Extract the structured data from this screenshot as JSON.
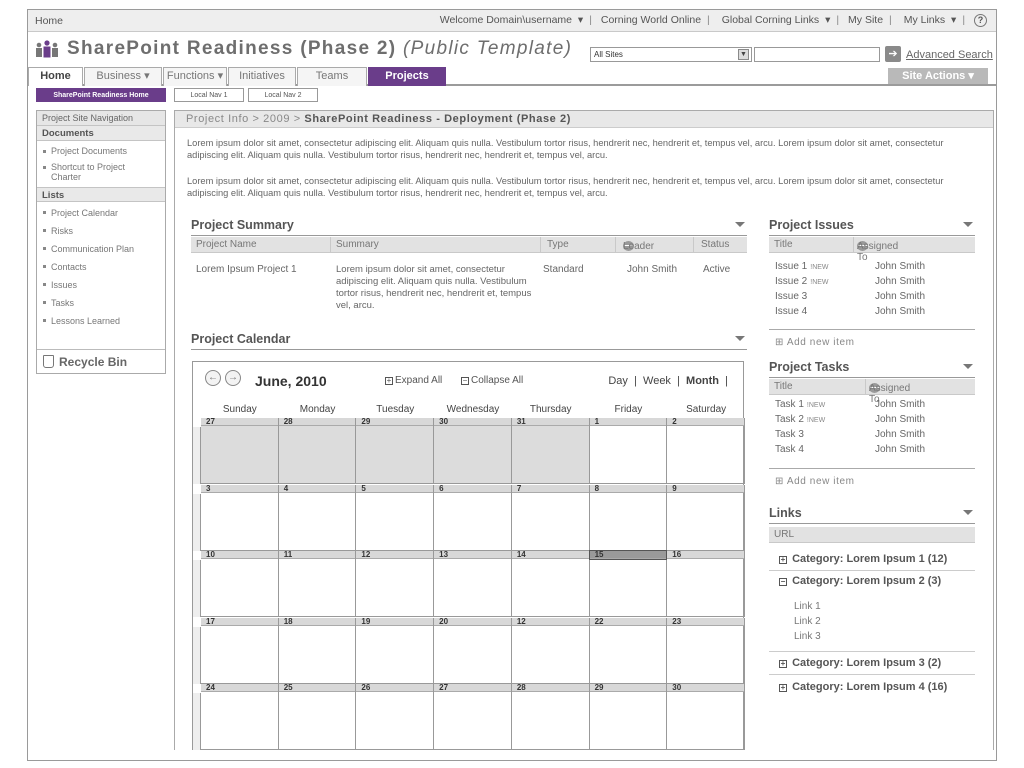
{
  "topbar": {
    "home": "Home",
    "welcome": "Welcome Domain\\username",
    "links": [
      "Corning World Online",
      "Global Corning Links",
      "My Site",
      "My Links"
    ],
    "help": "?"
  },
  "header": {
    "title": "SharePoint Readiness (Phase 2)",
    "subtitle": "(Public Template)",
    "scope_value": "All Sites",
    "advanced_search": "Advanced Search"
  },
  "tabs": [
    {
      "label": "Home"
    },
    {
      "label": "Business ▾"
    },
    {
      "label": "Functions ▾"
    },
    {
      "label": "Initiatives"
    },
    {
      "label": "Teams"
    },
    {
      "label": "Projects"
    }
  ],
  "site_actions": "Site Actions ▾",
  "local_nav": [
    "SharePoint Readiness Home",
    "Local Nav 1",
    "Local Nav 2"
  ],
  "leftnav": {
    "heading": "Project Site Navigation",
    "documents_label": "Documents",
    "documents": [
      "Project Documents",
      "Shortcut to Project Charter"
    ],
    "lists_label": "Lists",
    "lists": [
      "Project Calendar",
      "Risks",
      "Communication Plan",
      "Contacts",
      "Issues",
      "Tasks",
      "Lessons Learned"
    ],
    "recycle": "Recycle Bin"
  },
  "breadcrumb": {
    "path": "Project Info > 2009 > ",
    "current": "SharePoint Readiness - Deployment (Phase 2)"
  },
  "intro": [
    "Lorem ipsum dolor sit amet, consectetur adipiscing elit. Aliquam quis nulla. Vestibulum tortor risus, hendrerit nec, hendrerit et, tempus vel, arcu. Lorem ipsum dolor sit amet, consectetur adipiscing elit. Aliquam quis nulla. Vestibulum tortor risus, hendrerit nec, hendrerit et, tempus vel, arcu.",
    "Lorem ipsum dolor sit amet, consectetur adipiscing elit. Aliquam quis nulla. Vestibulum tortor risus, hendrerit nec, hendrerit et, tempus vel, arcu. Lorem ipsum dolor sit amet, consectetur adipiscing elit. Aliquam quis nulla. Vestibulum tortor risus, hendrerit nec, hendrerit et, tempus vel, arcu."
  ],
  "summary": {
    "title": "Project Summary",
    "columns": [
      "Project Name",
      "Summary",
      "Type",
      "Leader",
      "Status"
    ],
    "row": {
      "name": "Lorem Ipsum Project 1",
      "summary": "Lorem ipsum dolor sit amet, consectetur adipiscing elit. Aliquam quis nulla. Vestibulum tortor risus, hendrerit nec, hendrerit et, tempus vel, arcu.",
      "type": "Standard",
      "leader": "John Smith",
      "status": "Active"
    }
  },
  "calendar": {
    "title": "Project Calendar",
    "month": "June, 2010",
    "expand": "Expand All",
    "collapse": "Collapse All",
    "views": [
      "Day",
      "Week",
      "Month"
    ],
    "days": [
      "Sunday",
      "Monday",
      "Tuesday",
      "Wednesday",
      "Thursday",
      "Friday",
      "Saturday"
    ],
    "weeks": [
      [
        "27",
        "28",
        "29",
        "30",
        "31",
        "1",
        "2"
      ],
      [
        "3",
        "4",
        "5",
        "6",
        "7",
        "8",
        "9"
      ],
      [
        "10",
        "11",
        "12",
        "13",
        "14",
        "15",
        "16"
      ],
      [
        "17",
        "18",
        "19",
        "20",
        "12",
        "22",
        "23"
      ],
      [
        "24",
        "25",
        "26",
        "27",
        "28",
        "29",
        "30"
      ]
    ]
  },
  "issues": {
    "title": "Project Issues",
    "col_title": "Title",
    "col_assigned": "Assigned To",
    "items": [
      {
        "title": "Issue 1",
        "new": "!NEW",
        "assigned": "John Smith"
      },
      {
        "title": "Issue 2",
        "new": "!NEW",
        "assigned": "John Smith"
      },
      {
        "title": "Issue 3",
        "new": "",
        "assigned": "John Smith"
      },
      {
        "title": "Issue 4",
        "new": "",
        "assigned": "John Smith"
      }
    ],
    "add": "Add new item"
  },
  "tasks": {
    "title": "Project Tasks",
    "col_title": "Title",
    "col_assigned": "Assigned To",
    "items": [
      {
        "title": "Task 1",
        "new": "!NEW",
        "assigned": "John Smith"
      },
      {
        "title": "Task 2",
        "new": "!NEW",
        "assigned": "John Smith"
      },
      {
        "title": "Task 3",
        "new": "",
        "assigned": "John Smith"
      },
      {
        "title": "Task 4",
        "new": "",
        "assigned": "John Smith"
      }
    ],
    "add": "Add new item"
  },
  "links": {
    "title": "Links",
    "col": "URL",
    "categories": [
      "Category: Lorem Ipsum 1 (12)",
      "Category: Lorem Ipsum 2 (3)",
      "Category: Lorem Ipsum 3 (2)",
      "Category: Lorem Ipsum 4 (16)"
    ],
    "items": [
      "Link 1",
      "Link 2",
      "Link 3"
    ]
  },
  "colors": {
    "accent": "#6a3d8a",
    "grey": "#dcdcdc"
  }
}
